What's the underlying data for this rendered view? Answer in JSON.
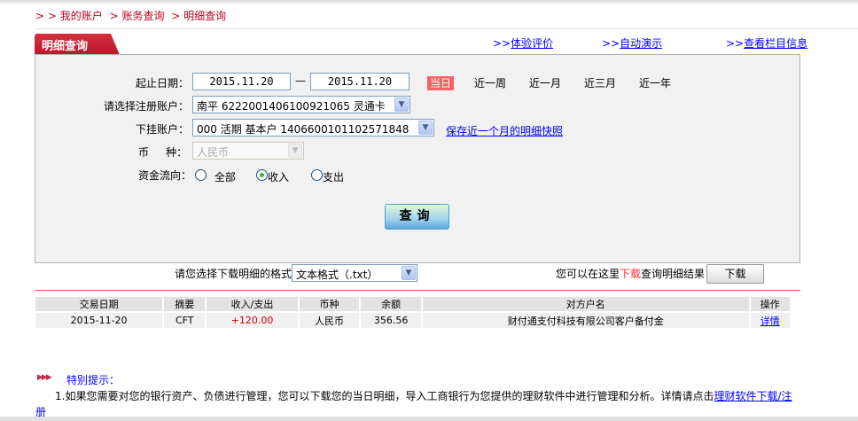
{
  "breadcrumb": {
    "items": [
      "> > 我的账户",
      "> 账务查询",
      "> 明细查询"
    ]
  },
  "tab": {
    "title": "明细查询"
  },
  "top_links": [
    {
      "prefix": ">>",
      "label": "体验评价"
    },
    {
      "prefix": ">>",
      "label": "自动演示"
    },
    {
      "prefix": ">>",
      "label": "查看栏目信息"
    }
  ],
  "form": {
    "date_label": "起止日期：",
    "start_date": "2015.11.20",
    "dash": "—",
    "end_date": "2015.11.20",
    "quick_ranges": [
      "当日",
      "近一周",
      "近一月",
      "近三月",
      "近一年"
    ],
    "account_label": "请选择注册账户：",
    "account_value": "南平  6222001406100921065  灵通卡",
    "sub_account_label": "下挂账户：",
    "sub_account_value": "000  活期  基本户  1406600101102571848",
    "snapshot_link": "保存近一个月的明细快照",
    "currency_label": "币     种：",
    "currency_value": "人民币",
    "flow_label": "资金流向：",
    "flow_options": [
      "全部",
      "收入",
      "支出"
    ],
    "flow_selected": "收入",
    "query_button": "查询"
  },
  "download": {
    "format_label": "请您选择下载明细的格式",
    "format_value": "文本格式（.txt）",
    "hint_pre": "您可以在这里",
    "hint_red": "下载",
    "hint_post": "查询明细结果",
    "button": "下载"
  },
  "table": {
    "headers": [
      "交易日期",
      "摘要",
      "收入/支出",
      "币种",
      "余额",
      "对方户名",
      "操作"
    ],
    "rows": [
      [
        "2015-11-20",
        "CFT",
        "+120.00",
        "人民币",
        "356.56",
        "财付通支付科技有限公司客户备付金",
        "详情"
      ]
    ]
  },
  "notes": {
    "title": "特别提示：",
    "text": "1.如果您需要对您的银行资产、负债进行管理，您可以下载您的当日明细，导入工商银行为您提供的理财软件中进行管理和分析。详情请点击",
    "link": "理财软件下载/注册"
  }
}
